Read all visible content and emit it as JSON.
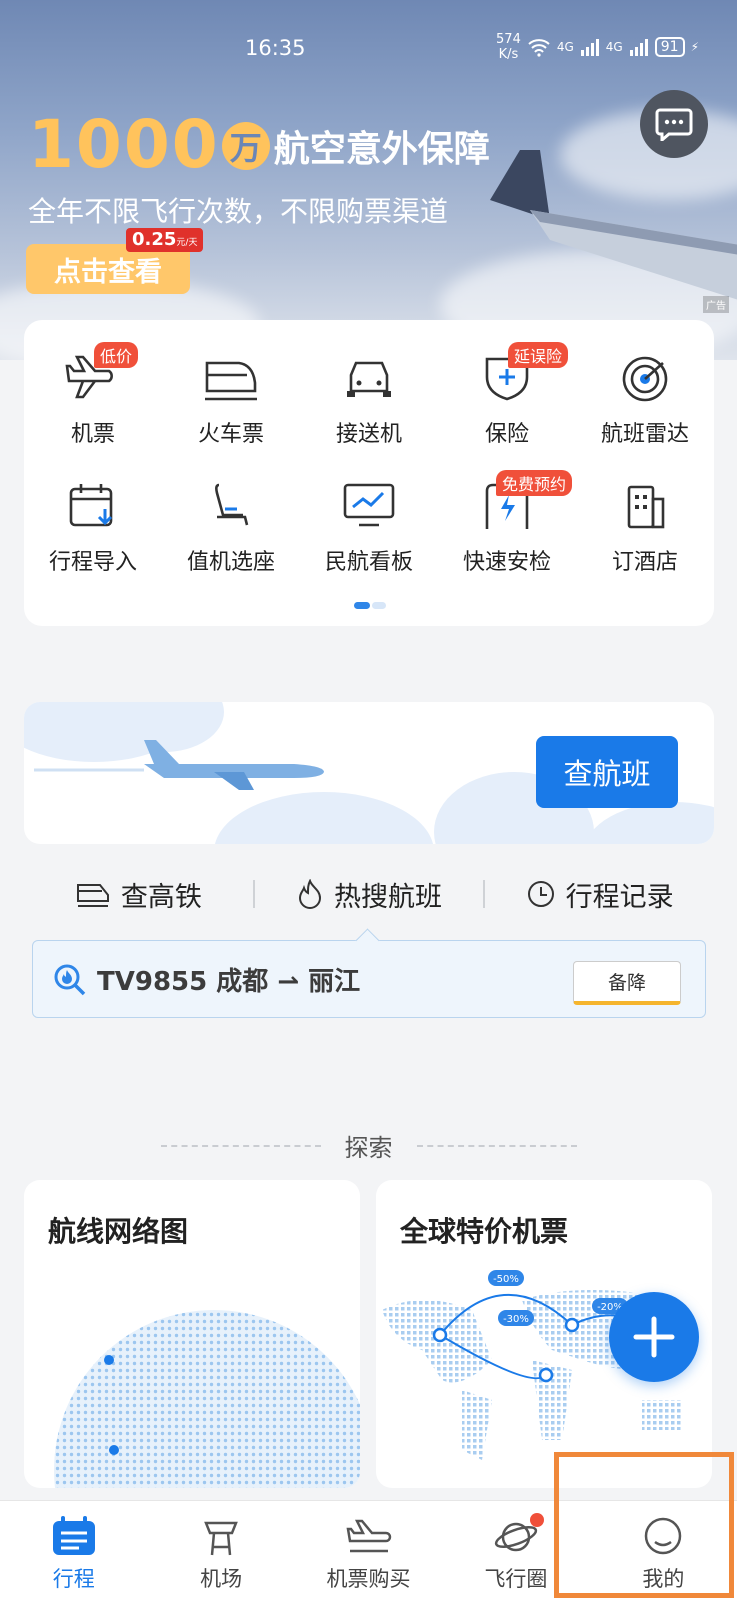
{
  "status": {
    "time": "16:35",
    "speed_top": "574",
    "speed_unit": "K/s",
    "net1": "4G",
    "net2": "4G",
    "battery": "91"
  },
  "banner": {
    "amount": "1000",
    "unit": "万",
    "title": "航空意外保障",
    "subtitle": "全年不限飞行次数，不限购票渠道",
    "button": "点击查看",
    "price": "0.25",
    "price_unit": "元/天",
    "ad_label": "广告"
  },
  "services": [
    {
      "label": "机票",
      "tag": "低价",
      "icon": "plane-icon"
    },
    {
      "label": "火车票",
      "tag": "",
      "icon": "train-icon"
    },
    {
      "label": "接送机",
      "tag": "",
      "icon": "car-icon"
    },
    {
      "label": "保险",
      "tag": "延误险",
      "icon": "shield-icon"
    },
    {
      "label": "航班雷达",
      "tag": "",
      "icon": "radar-icon"
    },
    {
      "label": "行程导入",
      "tag": "",
      "icon": "calendar-import-icon"
    },
    {
      "label": "值机选座",
      "tag": "",
      "icon": "seat-icon"
    },
    {
      "label": "民航看板",
      "tag": "",
      "icon": "monitor-chart-icon"
    },
    {
      "label": "快速安检",
      "tag": "免费预约",
      "icon": "security-check-icon"
    },
    {
      "label": "订酒店",
      "tag": "",
      "icon": "hotel-icon"
    }
  ],
  "flight_search": {
    "button": "查航班"
  },
  "links": [
    {
      "label": "查高铁",
      "icon": "train-outline-icon"
    },
    {
      "label": "热搜航班",
      "icon": "flame-icon"
    },
    {
      "label": "行程记录",
      "icon": "clock-icon"
    }
  ],
  "hot_flight": {
    "text": "TV9855 成都 ⇀ 丽江",
    "status": "备降"
  },
  "explore": {
    "label": "探索",
    "cards": [
      {
        "title": "航线网络图"
      },
      {
        "title": "全球特价机票",
        "discounts": [
          "-50%",
          "-30%",
          "-20%"
        ]
      }
    ]
  },
  "nav": [
    {
      "label": "行程",
      "icon": "itinerary-icon",
      "active": true
    },
    {
      "label": "机场",
      "icon": "airport-tower-icon",
      "active": false
    },
    {
      "label": "机票购买",
      "icon": "plane-ticket-icon",
      "active": false
    },
    {
      "label": "飞行圈",
      "icon": "planet-icon",
      "active": false
    },
    {
      "label": "我的",
      "icon": "profile-icon",
      "active": false
    }
  ],
  "colors": {
    "accent": "#1a7ae8",
    "promo_gold": "#ffc35c",
    "tag_red": "#f0503a"
  }
}
